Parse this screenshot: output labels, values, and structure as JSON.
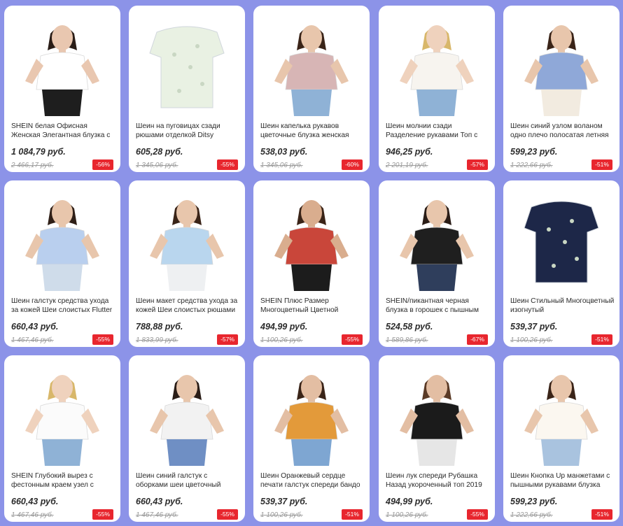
{
  "products": [
    {
      "title": "SHEIN белая Офисная Женская Элегантная блузка с рукавами-",
      "price": "1 084,79 руб.",
      "old_price": "2 466,17 руб.",
      "discount": "-56%",
      "colors": {
        "top": "#ffffff",
        "bottom": "#1e1e1e",
        "hair": "#2a1d17",
        "skin": "#e9c7b0"
      }
    },
    {
      "title": "Шеин на пуговицах сзади рюшами отделкой Ditsy",
      "price": "605,28 руб.",
      "old_price": "1 345,06 руб.",
      "discount": "-55%",
      "colors": {
        "top": "#e9f1e3",
        "bottom": "#e9f1e3",
        "hair": "#ffffff",
        "skin": "#ffffff"
      }
    },
    {
      "title": "Шеин капелька рукавов цветочные блузка женская",
      "price": "538,03 руб.",
      "old_price": "1 345,06 руб.",
      "discount": "-60%",
      "colors": {
        "top": "#d7b5b5",
        "bottom": "#8fb2d6",
        "hair": "#3a2418",
        "skin": "#e8c6ac"
      }
    },
    {
      "title": "Шеин молнии сзади Разделение рукавами Топ с",
      "price": "946,25 руб.",
      "old_price": "2 201,19 руб.",
      "discount": "-57%",
      "colors": {
        "top": "#f7f4ef",
        "bottom": "#8fb2d6",
        "hair": "#d8b76a",
        "skin": "#efd2bd"
      }
    },
    {
      "title": "Шеин синий узлом воланом одно плечо полосатая летняя",
      "price": "599,23 руб.",
      "old_price": "1 222,66 руб.",
      "discount": "-51%",
      "colors": {
        "top": "#8fa8d8",
        "bottom": "#f2ebe0",
        "hair": "#3a2418",
        "skin": "#e8c6ac"
      }
    },
    {
      "title": "Шеин галстук средства ухода за кожей Шеи слоистых Flutter",
      "price": "660,43 руб.",
      "old_price": "1 467,46 руб.",
      "discount": "-55%",
      "colors": {
        "top": "#b9cfee",
        "bottom": "#cfdcea",
        "hair": "#2f1f17",
        "skin": "#e8c6ac"
      }
    },
    {
      "title": "Шеин макет средства ухода за кожей Шеи слоистых рюшами",
      "price": "788,88 руб.",
      "old_price": "1 833,99 руб.",
      "discount": "-57%",
      "colors": {
        "top": "#b9d6ee",
        "bottom": "#eef0f2",
        "hair": "#3a2418",
        "skin": "#e8c6ac"
      }
    },
    {
      "title": "SHEIN Плюс Размер Многоцветный Цветной",
      "price": "494,99 руб.",
      "old_price": "1 100,26 руб.",
      "discount": "-55%",
      "colors": {
        "top": "#c9463a",
        "bottom": "#1c1c1c",
        "hair": "#3a2418",
        "skin": "#d9ad8e"
      }
    },
    {
      "title": "SHEIN/пикантная черная блузка в горошек с пышным",
      "price": "524,58 руб.",
      "old_price": "1 589,86 руб.",
      "discount": "-67%",
      "colors": {
        "top": "#1f1f1f",
        "bottom": "#2f3e5c",
        "hair": "#2a1d17",
        "skin": "#e8c6ac"
      }
    },
    {
      "title": "Шеин Стильный Многоцветный изогнутый",
      "price": "539,37 руб.",
      "old_price": "1 100,26 руб.",
      "discount": "-51%",
      "colors": {
        "top": "#1d2748",
        "bottom": "#1d2748",
        "hair": "#ffffff",
        "skin": "#ffffff"
      }
    },
    {
      "title": "SHEIN Глубокий вырез с фестонным краем узел с",
      "price": "660,43 руб.",
      "old_price": "1 467,46 руб.",
      "discount": "-55%",
      "colors": {
        "top": "#fbfbfb",
        "bottom": "#8fb2d6",
        "hair": "#d8b76a",
        "skin": "#efd2bd"
      }
    },
    {
      "title": "Шеин синий галстук с оборками шеи цветочный",
      "price": "660,43 руб.",
      "old_price": "1 467,46 руб.",
      "discount": "-55%",
      "colors": {
        "top": "#f2f2f2",
        "bottom": "#6f8fc4",
        "hair": "#2a1d17",
        "skin": "#e8c6ac"
      }
    },
    {
      "title": "Шеин Оранжевый сердце печати галстук спереди бандо",
      "price": "539,37 руб.",
      "old_price": "1 100,26 руб.",
      "discount": "-51%",
      "colors": {
        "top": "#e39a3a",
        "bottom": "#7ea6d2",
        "hair": "#3a2418",
        "skin": "#e3bea3"
      }
    },
    {
      "title": "Шеин лук спереди Рубашка Назад укороченный топ 2019",
      "price": "494,99 руб.",
      "old_price": "1 100,26 руб.",
      "discount": "-55%",
      "colors": {
        "top": "#1b1b1b",
        "bottom": "#e6e6e6",
        "hair": "#5a3a26",
        "skin": "#e3bea3"
      }
    },
    {
      "title": "Шеин Кнопка Up манжетами с пышными рукавами блузка",
      "price": "599,23 руб.",
      "old_price": "1 222,66 руб.",
      "discount": "-51%",
      "colors": {
        "top": "#fbf7f0",
        "bottom": "#a9c3df",
        "hair": "#3a2418",
        "skin": "#e8c6ac"
      }
    }
  ]
}
